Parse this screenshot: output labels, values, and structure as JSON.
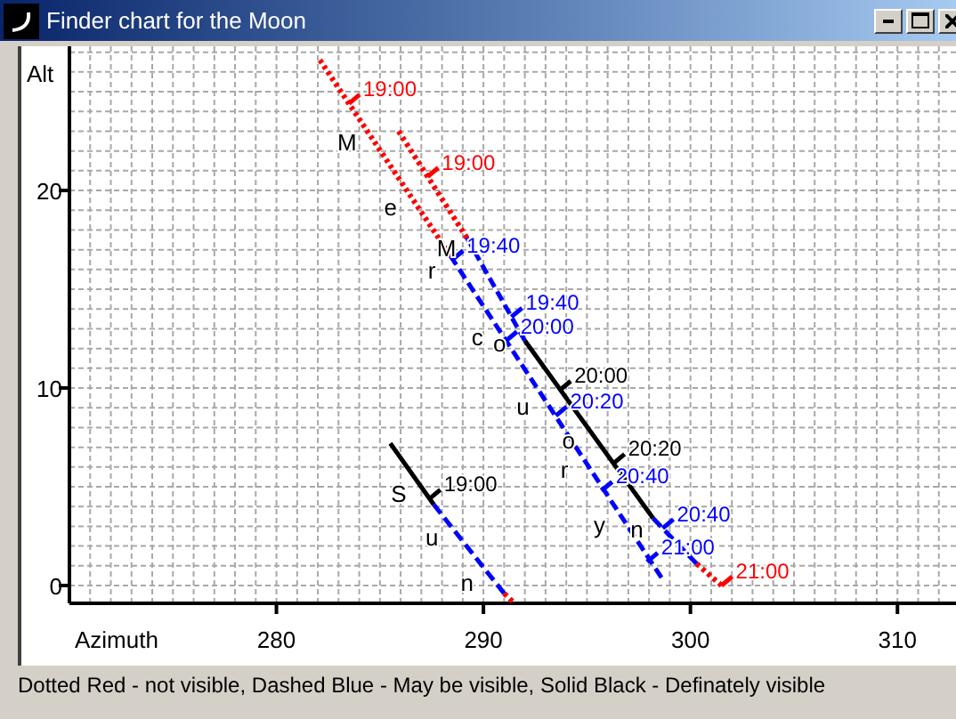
{
  "window": {
    "title": "Finder chart for the Moon",
    "buttons": [
      {
        "kind": "minimize"
      },
      {
        "kind": "maximize"
      },
      {
        "kind": "close"
      }
    ]
  },
  "chart": {
    "chart_data": {
      "type": "line",
      "xlabel": "Azimuth",
      "ylabel": "Alt",
      "xticks": [
        280,
        290,
        300,
        310
      ],
      "yticks": [
        0,
        10,
        20
      ],
      "xlim": [
        270,
        313
      ],
      "ylim": [
        -0.9,
        27.3
      ],
      "grid": true,
      "series": [
        {
          "color": "#ff0000",
          "line_style": "dotted",
          "x": [
            282.1,
            288.4
          ],
          "values": [
            26.6,
            16.7
          ]
        },
        {
          "color": "#0000ff",
          "line_style": "dashed",
          "x": [
            288.4,
            298.6
          ],
          "values": [
            16.7,
            0.4
          ]
        },
        {
          "color": "#ff0000",
          "line_style": "dotted",
          "x": [
            285.9,
            289.2
          ],
          "values": [
            23.0,
            17.6
          ]
        },
        {
          "color": "#0000ff",
          "line_style": "dashed",
          "x": [
            289.2,
            292.0
          ],
          "values": [
            17.6,
            12.4
          ]
        },
        {
          "color": "#000000",
          "line_style": "solid",
          "x": [
            292.0,
            298.2
          ],
          "values": [
            12.4,
            3.4
          ]
        },
        {
          "color": "#0000ff",
          "line_style": "dashed",
          "x": [
            298.2,
            300.3
          ],
          "values": [
            3.4,
            1.1
          ]
        },
        {
          "color": "#ff0000",
          "line_style": "dotted",
          "x": [
            300.3,
            301.5
          ],
          "values": [
            1.1,
            0.0
          ]
        },
        {
          "color": "#000000",
          "line_style": "solid",
          "x": [
            285.5,
            287.6
          ],
          "values": [
            7.2,
            4.1
          ]
        },
        {
          "color": "#0000ff",
          "line_style": "dashed",
          "x": [
            287.6,
            291.0
          ],
          "values": [
            4.1,
            -0.4
          ]
        },
        {
          "color": "#ff0000",
          "line_style": "dotted",
          "x": [
            291.0,
            291.4
          ],
          "values": [
            -0.4,
            -0.8
          ]
        }
      ],
      "annotations": [
        {
          "text": "19:00",
          "x": 283.5,
          "y": 24.4
        },
        {
          "text": "19:40",
          "x": 288.5,
          "y": 16.5
        },
        {
          "text": "20:00",
          "x": 291.1,
          "y": 12.4
        },
        {
          "text": "20:20",
          "x": 293.5,
          "y": 8.6
        },
        {
          "text": "20:40",
          "x": 295.7,
          "y": 4.8
        },
        {
          "text": "21:00",
          "x": 297.9,
          "y": 1.2
        },
        {
          "text": "19:00",
          "x": 287.3,
          "y": 20.7
        },
        {
          "text": "19:40",
          "x": 291.35,
          "y": 13.6
        },
        {
          "text": "20:00",
          "x": 293.7,
          "y": 9.9
        },
        {
          "text": "20:20",
          "x": 296.3,
          "y": 6.2
        },
        {
          "text": "20:40",
          "x": 298.66,
          "y": 2.9
        },
        {
          "text": "21:00",
          "x": 301.5,
          "y": 0.0
        },
        {
          "text": "19:00",
          "x": 287.4,
          "y": 4.4
        }
      ]
    },
    "track_letters": [
      "M",
      "e",
      "r",
      "c",
      "u",
      "r",
      "y",
      "M",
      "o",
      "o",
      "n",
      "S",
      "u",
      "n"
    ]
  },
  "legend": "Dotted Red - not visible, Dashed Blue - May be visible, Solid Black - Definately visible"
}
